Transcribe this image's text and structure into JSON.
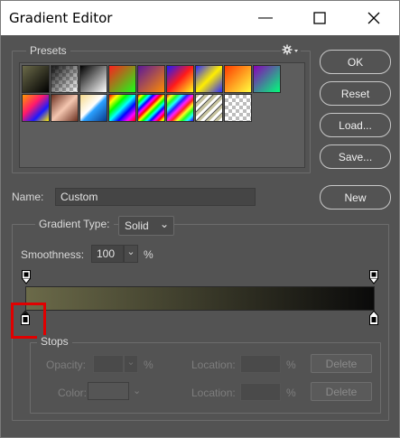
{
  "window": {
    "title": "Gradient Editor",
    "minimize_glyph": "—",
    "maximize_glyph": "☐",
    "close_glyph": "✕"
  },
  "presets": {
    "label": "Presets",
    "menu_icon": "gear-icon",
    "menu_glyph": "✱▾"
  },
  "buttons": {
    "ok": "OK",
    "reset": "Reset",
    "load": "Load...",
    "save": "Save...",
    "new": "New"
  },
  "name": {
    "label": "Name:",
    "value": "Custom"
  },
  "gradient_type": {
    "label": "Gradient Type:",
    "value": "Solid",
    "arrow": "⌄"
  },
  "smoothness": {
    "label": "Smoothness:",
    "value": "100",
    "arrow": "⌄",
    "unit": "%"
  },
  "gradient": {
    "start_color": "#6b6a49",
    "end_color": "#0a0a0a"
  },
  "stops": {
    "label": "Stops",
    "opacity_label": "Opacity:",
    "opacity_unit": "%",
    "color_label": "Color:",
    "location_label": "Location:",
    "location_unit": "%",
    "delete_label": "Delete",
    "arrow": "⌄"
  },
  "colors": {
    "highlight": "#e00000"
  }
}
